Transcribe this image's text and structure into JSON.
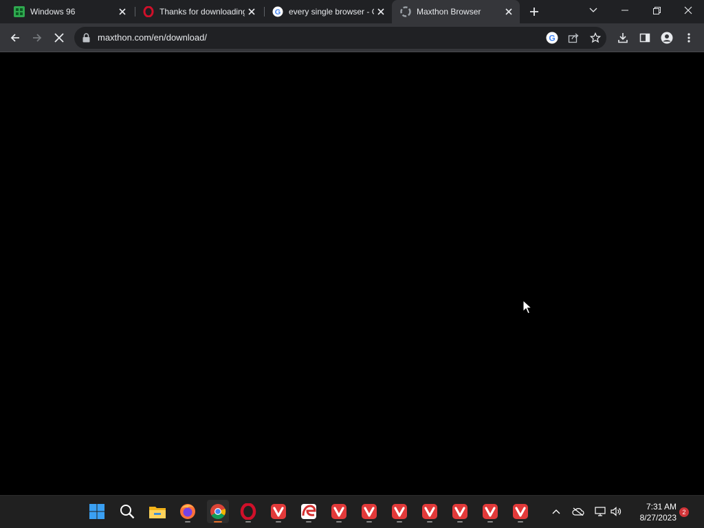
{
  "browser": {
    "tabs": [
      {
        "title": "Windows 96",
        "icon": "windows96-icon"
      },
      {
        "title": "Thanks for downloading",
        "icon": "opera-icon"
      },
      {
        "title": "every single browser - G",
        "icon": "google-icon"
      },
      {
        "title": "Maxthon Browser",
        "icon": "maxthon-icon",
        "active": true
      }
    ],
    "address": {
      "url": "maxthon.com/en/download/"
    }
  },
  "taskbar": {
    "apps": [
      "start-icon",
      "search-icon",
      "file-explorer-icon",
      "firefox-icon",
      "chrome-icon",
      "opera-icon",
      "vivaldi-icon",
      "edge-icon",
      "vivaldi-icon",
      "vivaldi-icon",
      "vivaldi-icon",
      "vivaldi-icon",
      "vivaldi-icon",
      "vivaldi-icon",
      "vivaldi-icon"
    ],
    "clock": {
      "time": "7:31 AM",
      "date": "8/27/2023"
    },
    "notifications": "2"
  },
  "colors": {
    "tabstrip": "#202124",
    "toolbar": "#35363a",
    "omnibox": "#202124",
    "content": "#000000",
    "taskbar": "#202020"
  }
}
